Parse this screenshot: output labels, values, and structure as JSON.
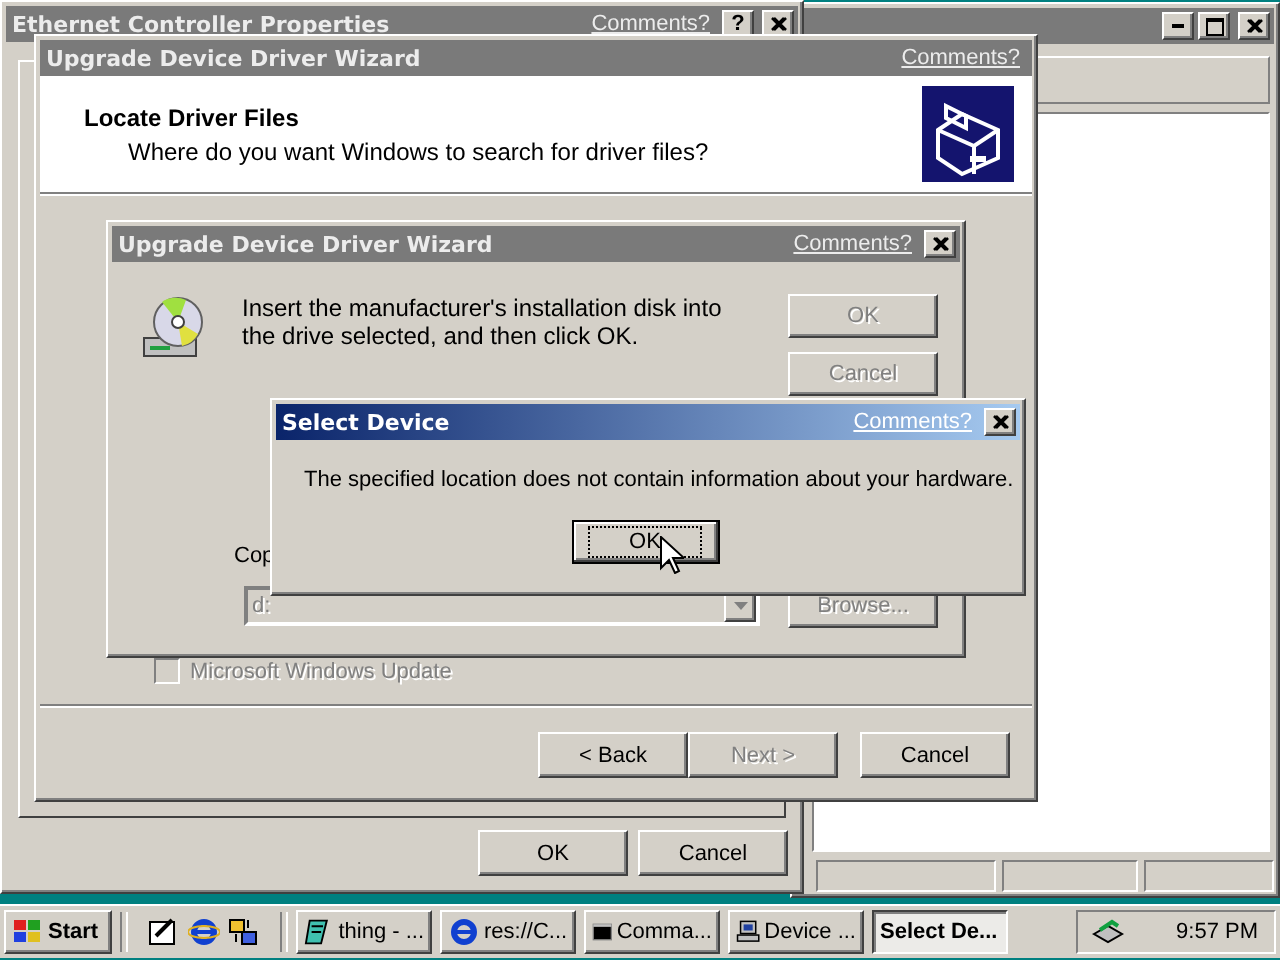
{
  "background_window": {
    "active": false
  },
  "properties_window": {
    "title": "Ethernet Controller Properties",
    "active": false,
    "comments": "Comments?",
    "help": "?",
    "buttons": [
      {
        "label": "OK",
        "disabled": false
      },
      {
        "label": "Cancel",
        "disabled": false
      }
    ]
  },
  "wizard": {
    "title": "Upgrade Device Driver Wizard",
    "active": false,
    "comments": "Comments?",
    "header_title": "Locate Driver Files",
    "header_subtitle": "Where do you want Windows to search for driver files?",
    "option": {
      "label": "Microsoft Windows Update",
      "checked": false,
      "disabled": true
    },
    "buttons": [
      {
        "label": "< Back",
        "disabled": false
      },
      {
        "label": "Next >",
        "disabled": true
      },
      {
        "label": "Cancel",
        "disabled": false
      }
    ]
  },
  "disk_dialog": {
    "title": "Upgrade Device Driver Wizard",
    "active": false,
    "comments": "Comments?",
    "message": "Insert the manufacturer's installation disk into the drive selected, and then click OK.",
    "buttons": [
      {
        "label": "OK",
        "disabled": true
      },
      {
        "label": "Cancel",
        "disabled": true
      }
    ],
    "copy_label": "Cop",
    "path": {
      "value": "d:",
      "disabled": true
    },
    "browse": {
      "label": "Browse...",
      "disabled": true
    }
  },
  "alert": {
    "title": "Select Device",
    "active": true,
    "comments": "Comments?",
    "message": "The specified location does not contain information about your hardware.",
    "button": {
      "label": "OK",
      "disabled": false,
      "focused": true
    }
  },
  "taskbar": {
    "start": "Start",
    "tasks": [
      {
        "label": "thing - ...",
        "selected": false
      },
      {
        "label": "res://C...",
        "selected": false
      },
      {
        "label": "Comma...",
        "selected": false
      },
      {
        "label": "Device ...",
        "selected": false
      },
      {
        "label": "Select De...",
        "selected": true
      }
    ],
    "clock": "9:57 PM"
  }
}
